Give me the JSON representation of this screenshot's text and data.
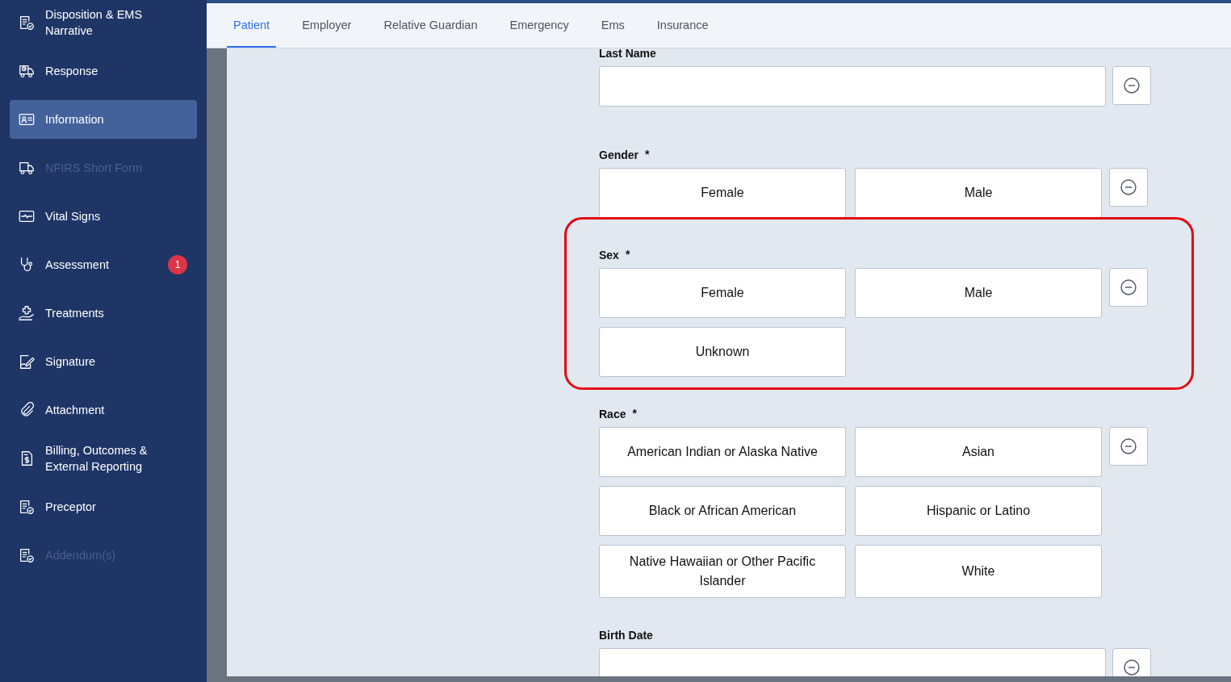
{
  "sidebar": {
    "items": [
      {
        "label": "Disposition & EMS Narrative",
        "selected": false,
        "disabled": false
      },
      {
        "label": "Response",
        "selected": false,
        "disabled": false
      },
      {
        "label": "Information",
        "selected": true,
        "disabled": false
      },
      {
        "label": "NFIRS Short Form",
        "selected": false,
        "disabled": true
      },
      {
        "label": "Vital Signs",
        "selected": false,
        "disabled": false
      },
      {
        "label": "Assessment",
        "selected": false,
        "disabled": false,
        "badge": "1"
      },
      {
        "label": "Treatments",
        "selected": false,
        "disabled": false
      },
      {
        "label": "Signature",
        "selected": false,
        "disabled": false
      },
      {
        "label": "Attachment",
        "selected": false,
        "disabled": false
      },
      {
        "label": "Billing, Outcomes & External Reporting",
        "selected": false,
        "disabled": false
      },
      {
        "label": "Preceptor",
        "selected": false,
        "disabled": false
      },
      {
        "label": "Addendum(s)",
        "selected": false,
        "disabled": true
      }
    ]
  },
  "tabs": [
    {
      "label": "Patient",
      "selected": true
    },
    {
      "label": "Employer",
      "selected": false
    },
    {
      "label": "Relative Guardian",
      "selected": false
    },
    {
      "label": "Emergency",
      "selected": false
    },
    {
      "label": "Ems",
      "selected": false
    },
    {
      "label": "Insurance",
      "selected": false
    }
  ],
  "form": {
    "fields": [
      {
        "label": "Last Name",
        "kind": "text"
      },
      {
        "label": "Gender",
        "kind": "choice",
        "required_mark": "*",
        "options": [
          {
            "label": "Female",
            "selected": false
          },
          {
            "label": "Male",
            "selected": false
          }
        ]
      },
      {
        "label": "Sex",
        "kind": "choice",
        "required_mark": "*",
        "highlighted": true,
        "options": [
          {
            "label": "Female",
            "selected": false
          },
          {
            "label": "Male",
            "selected": false
          },
          {
            "label": "Unknown",
            "selected": false
          }
        ]
      },
      {
        "label": "Race",
        "kind": "choice",
        "required_mark": "*",
        "options": [
          {
            "label": "American Indian or Alaska Native",
            "selected": false
          },
          {
            "label": "Asian",
            "selected": false
          },
          {
            "label": "Black or African American",
            "selected": false
          },
          {
            "label": "Hispanic or Latino",
            "selected": false
          },
          {
            "label": "Native Hawaiian or Other Pacific Islander",
            "selected": false
          },
          {
            "label": "White",
            "selected": false
          }
        ]
      },
      {
        "label": "Birth Date",
        "kind": "text"
      }
    ]
  }
}
